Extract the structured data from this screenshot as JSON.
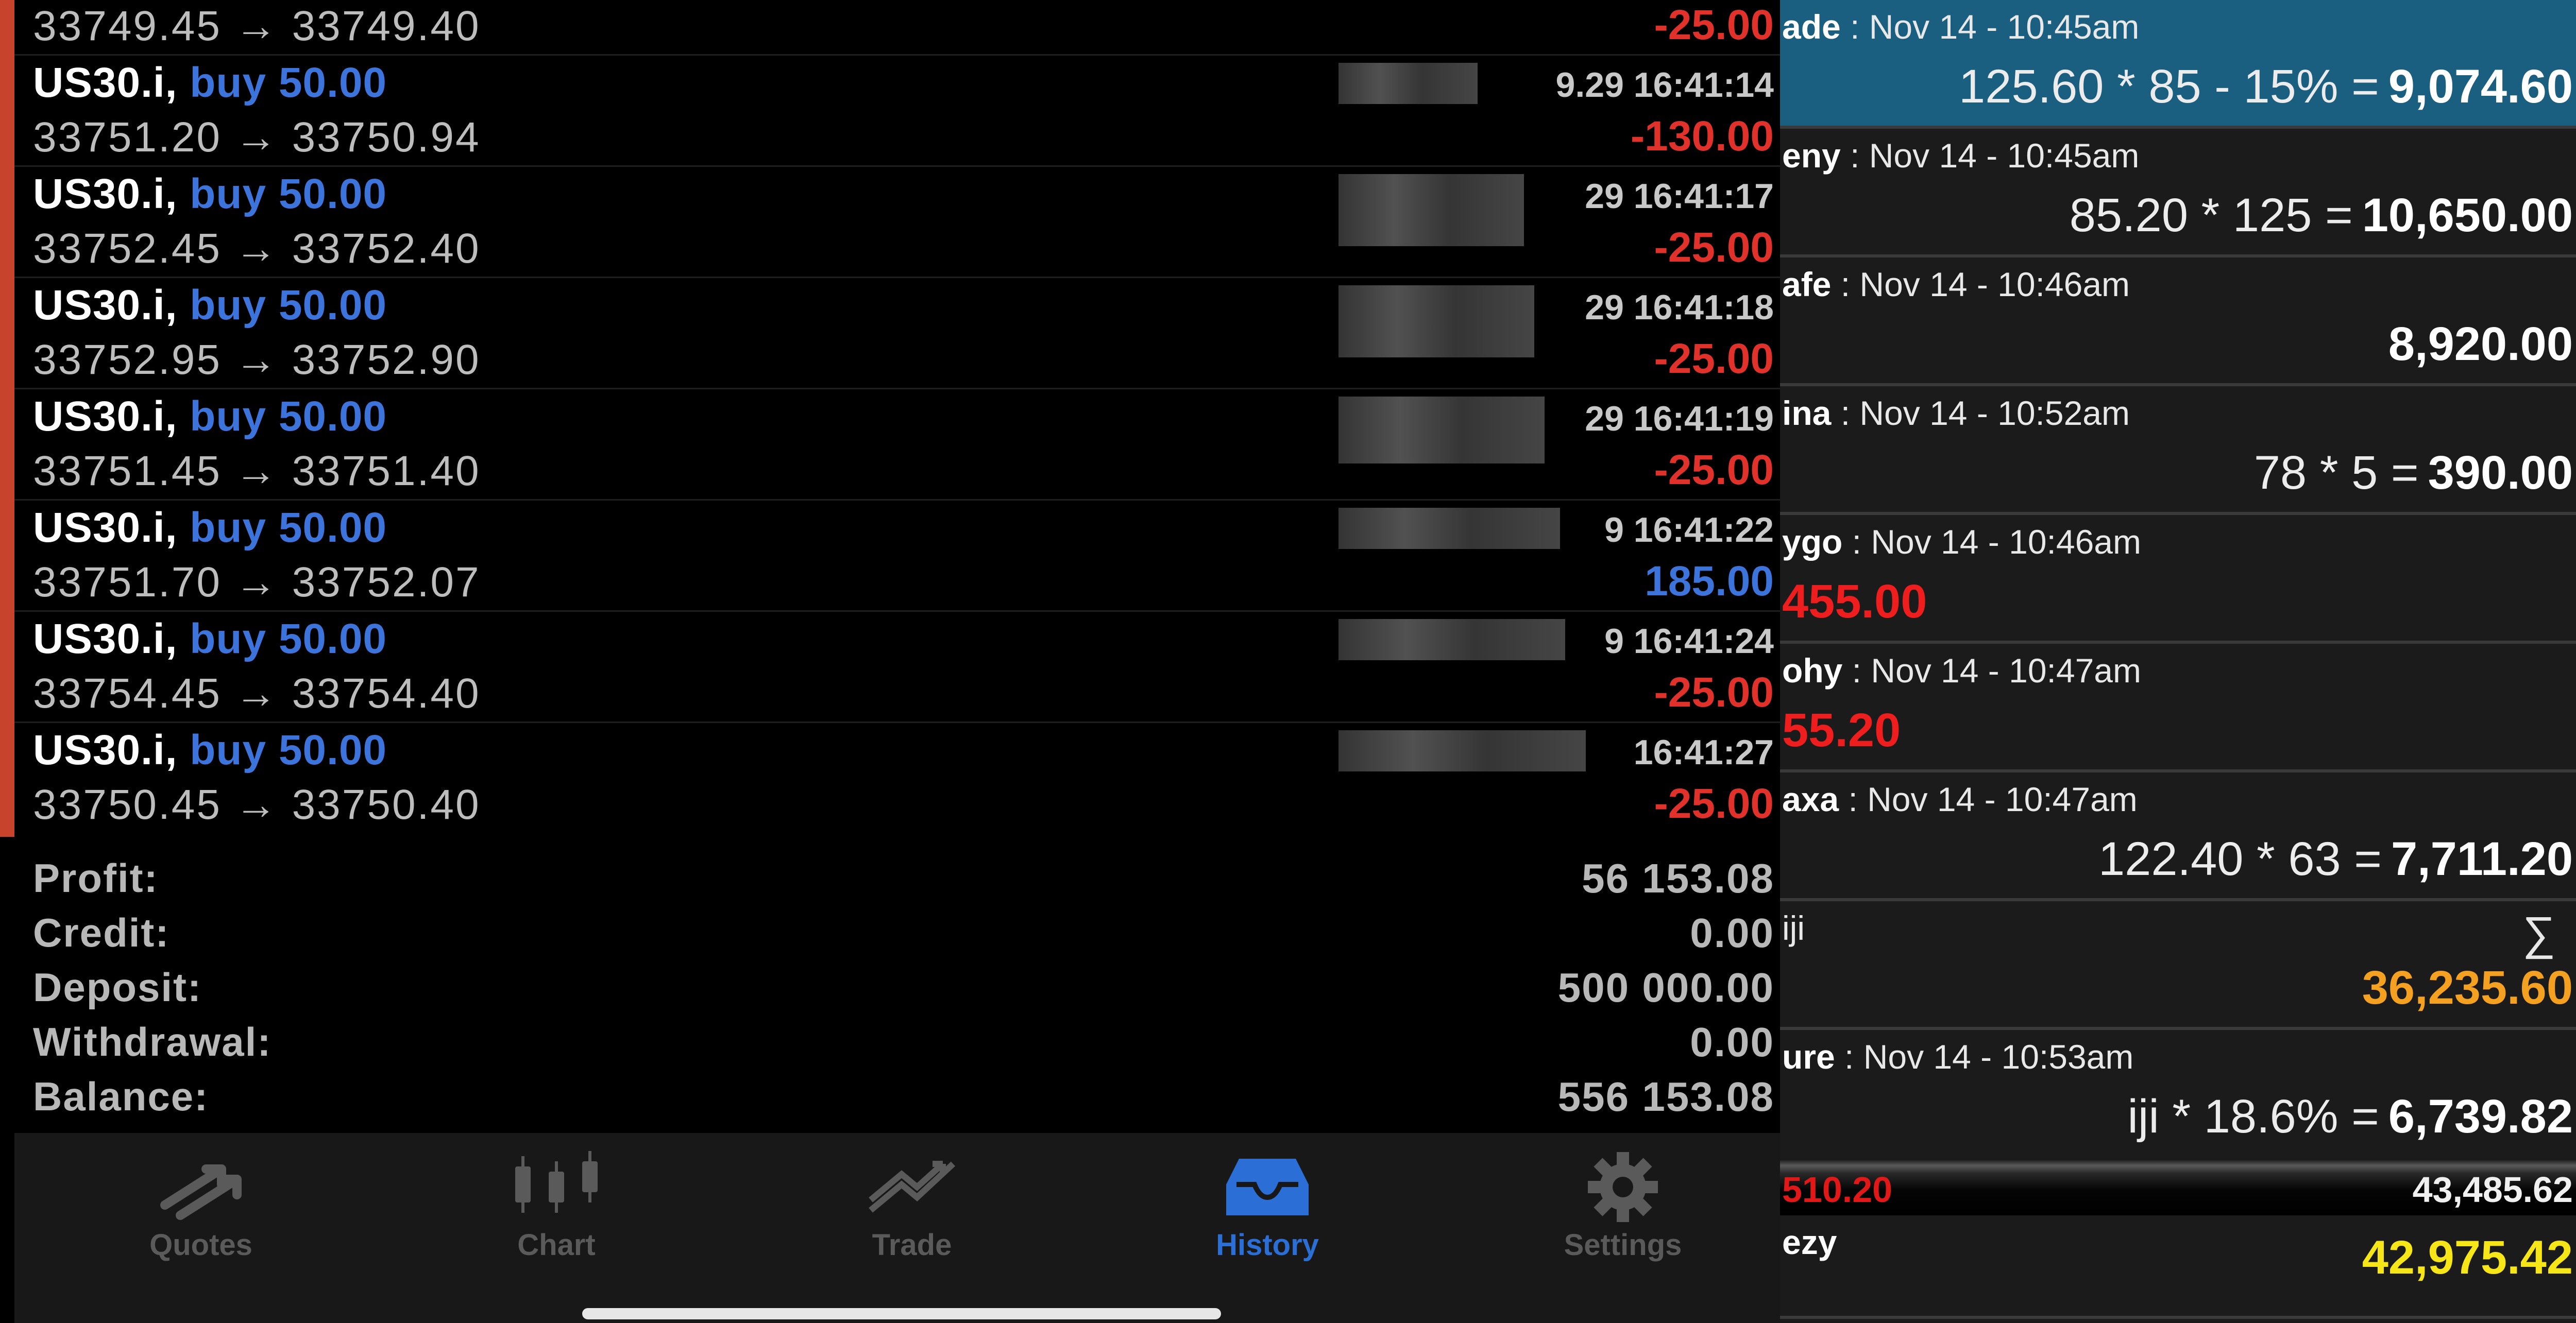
{
  "history": {
    "partial_row": {
      "prices": "33749.45 → 33749.40",
      "pl": "-25.00"
    },
    "trades": [
      {
        "symbol": "US30.i,",
        "side": "buy 50.00",
        "time": "9.29 16:41:14",
        "prices": "33751.20 → 33750.94",
        "pl": "-130.00"
      },
      {
        "symbol": "US30.i,",
        "side": "buy 50.00",
        "time": "29 16:41:17",
        "prices": "33752.45 → 33752.40",
        "pl": "-25.00"
      },
      {
        "symbol": "US30.i,",
        "side": "buy 50.00",
        "time": "29 16:41:18",
        "prices": "33752.95 → 33752.90",
        "pl": "-25.00"
      },
      {
        "symbol": "US30.i,",
        "side": "buy 50.00",
        "time": "29 16:41:19",
        "prices": "33751.45 → 33751.40",
        "pl": "-25.00"
      },
      {
        "symbol": "US30.i,",
        "side": "buy 50.00",
        "time": "9 16:41:22",
        "prices": "33751.70 → 33752.07",
        "pl": "185.00"
      },
      {
        "symbol": "US30.i,",
        "side": "buy 50.00",
        "time": "9 16:41:24",
        "prices": "33754.45 → 33754.40",
        "pl": "-25.00"
      },
      {
        "symbol": "US30.i,",
        "side": "buy 50.00",
        "time": "16:41:27",
        "prices": "33750.45 → 33750.40",
        "pl": "-25.00"
      }
    ],
    "summary": [
      {
        "label": "Profit:",
        "value": "56 153.08"
      },
      {
        "label": "Credit:",
        "value": "0.00"
      },
      {
        "label": "Deposit:",
        "value": "500 000.00"
      },
      {
        "label": "Withdrawal:",
        "value": "0.00"
      },
      {
        "label": "Balance:",
        "value": "556 153.08"
      }
    ],
    "tabs": [
      {
        "label": "Quotes",
        "icon": "quotes-icon",
        "active": false
      },
      {
        "label": "Chart",
        "icon": "chart-icon",
        "active": false
      },
      {
        "label": "Trade",
        "icon": "trade-icon",
        "active": false
      },
      {
        "label": "History",
        "icon": "history-icon",
        "active": true
      },
      {
        "label": "Settings",
        "icon": "settings-icon",
        "active": false
      }
    ]
  },
  "tape": {
    "entries": [
      {
        "name": "ade",
        "stamp": " : Nov 14 - 10:45am",
        "expr": "125.60 * 85 - 15% =",
        "result": "9,074.60"
      },
      {
        "name": "eny",
        "stamp": " : Nov 14 - 10:45am",
        "expr": "85.20 * 125 =",
        "result": "10,650.00"
      },
      {
        "name": "afe",
        "stamp": " : Nov 14 - 10:46am",
        "expr": "",
        "result": "8,920.00"
      },
      {
        "name": "ina",
        "stamp": " : Nov 14 - 10:52am",
        "expr": "78 * 5 =",
        "result": "390.00"
      },
      {
        "name": "ygo",
        "stamp": " : Nov 14 - 10:46am",
        "red_value": "455.00"
      },
      {
        "name": "ohy",
        "stamp": " : Nov 14 - 10:47am",
        "red_value": "55.20"
      },
      {
        "name": "axa",
        "stamp": " : Nov 14 - 10:47am",
        "expr": "122.40 * 63 =",
        "result": "7,711.20"
      }
    ],
    "sum_entry": {
      "name": "iji",
      "sigma": "∑",
      "total": "36,235.60"
    },
    "ure_entry": {
      "name": "ure",
      "stamp": " : Nov 14 - 10:53am",
      "expr": "iji * 18.6% =",
      "result": "6,739.82"
    },
    "band": {
      "left": "510.20",
      "right": "43,485.62"
    },
    "final": {
      "name": "ezy",
      "value": "42,975.42"
    }
  },
  "colors": {
    "loss": "#e0322a",
    "gain": "#3d74dc",
    "tape_highlight": "#1b5f80",
    "total_orange": "#f4a020",
    "final_yellow": "#f6e617"
  }
}
